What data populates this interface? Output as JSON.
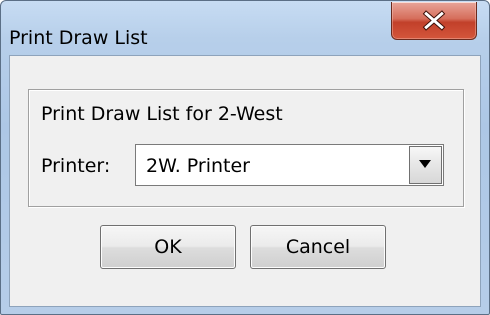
{
  "window": {
    "title": "Print Draw List",
    "close_icon": "close-icon"
  },
  "dialog": {
    "heading": "Print Draw List for 2-West",
    "printer_label": "Printer:",
    "printer_selected": "2W. Printer",
    "dropdown_icon": "chevron-down-icon"
  },
  "buttons": {
    "ok_label": "OK",
    "cancel_label": "Cancel"
  },
  "colors": {
    "close_button": "#c7503a",
    "frame": "#b7cfea",
    "client_bg": "#f0f0f0"
  }
}
